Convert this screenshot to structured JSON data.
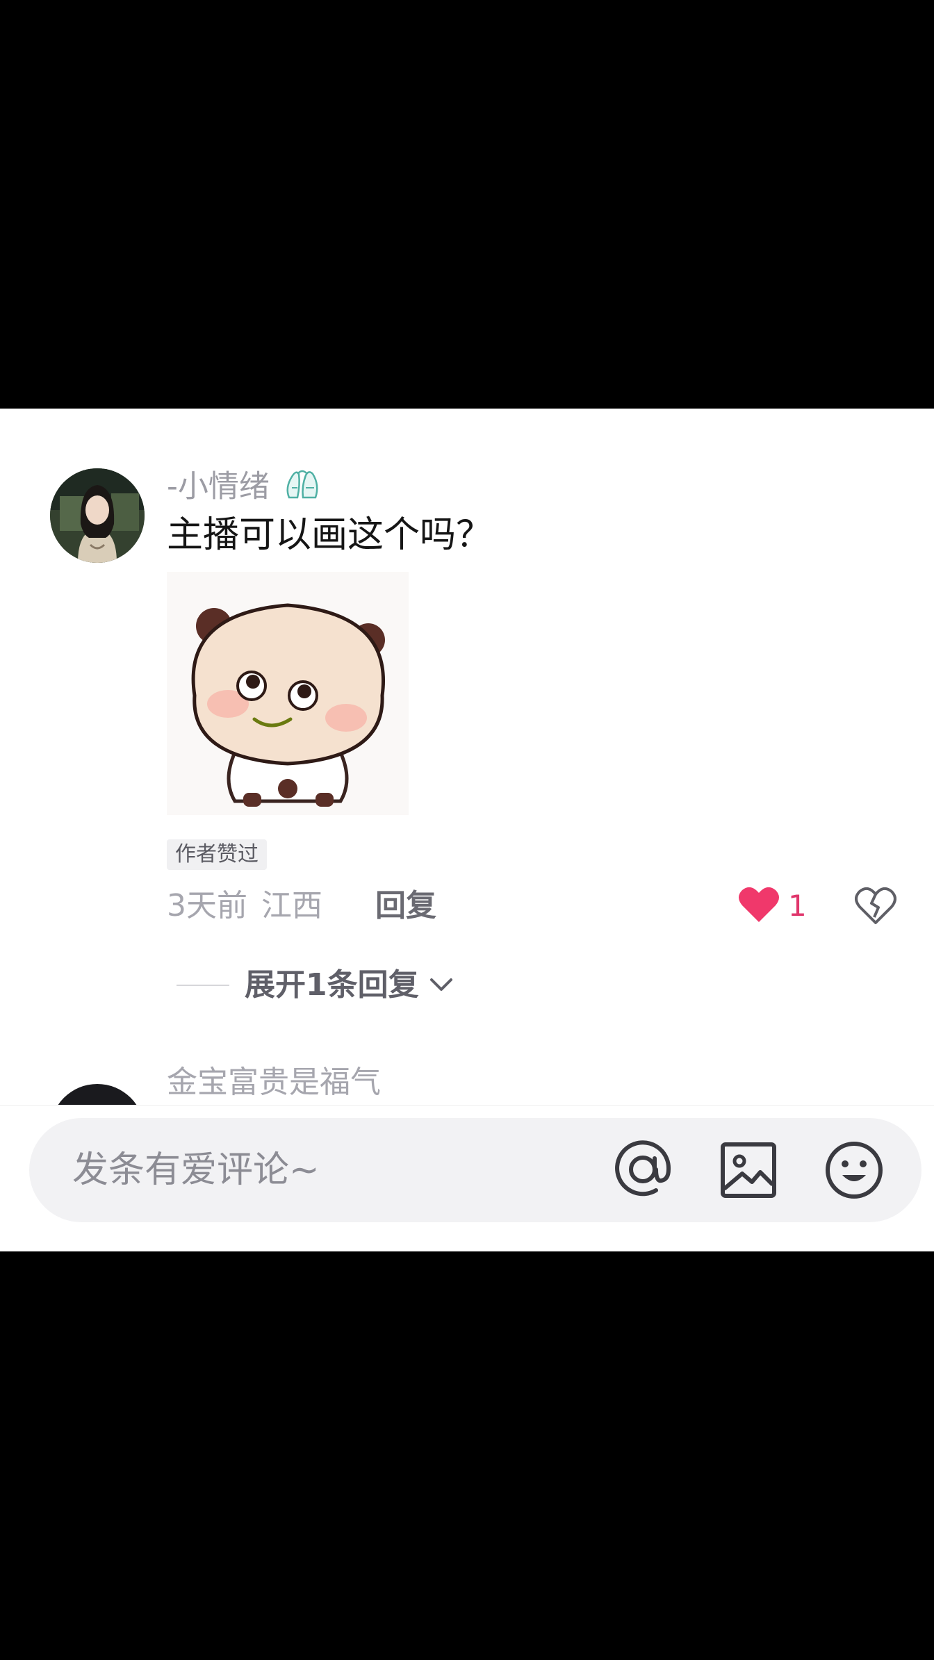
{
  "comment": {
    "username": "-小情绪",
    "text": "主播可以画这个吗？",
    "author_tag": "作者赞过",
    "time": "3天前",
    "location": "江西",
    "reply_label": "回复",
    "like_count": "1",
    "expand_label": "展开1条回复"
  },
  "next_comment": {
    "username": "金宝富贵是福气"
  },
  "input": {
    "placeholder": "发条有爱评论~"
  },
  "icons": {
    "badge": "ballet-shoes-icon",
    "like": "heart-icon",
    "dislike": "broken-heart-icon",
    "expand": "chevron-down-icon",
    "mention": "at-icon",
    "image": "image-icon",
    "emoji": "smiley-icon"
  },
  "colors": {
    "like": "#f0386b",
    "like_count": "#e0366c"
  }
}
